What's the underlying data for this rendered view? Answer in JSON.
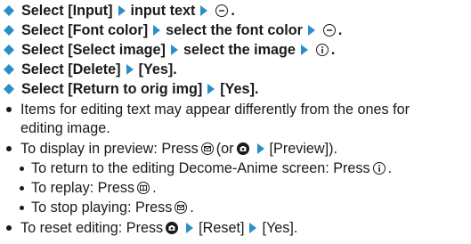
{
  "colors": {
    "accent": "#2a8fc9",
    "text": "#1a1a1a"
  },
  "steps": [
    {
      "parts": [
        "Select [Input]",
        "input text",
        "."
      ]
    },
    {
      "parts": [
        "Select [Font color]",
        "select the font color",
        "."
      ]
    },
    {
      "parts": [
        "Select [Select image]",
        "select the image",
        "."
      ]
    },
    {
      "parts": [
        "Select [Delete]",
        "[Yes]."
      ]
    },
    {
      "parts": [
        "Select [Return to orig img]",
        "[Yes]."
      ]
    }
  ],
  "notes": {
    "n1_line1": "Items for editing text may appear differently from the ones for",
    "n1_line2": "editing image.",
    "n2_a": "To display in preview: Press",
    "n2_b": "(or",
    "n2_c": "[Preview]).",
    "s1_a": "To return to the editing Decome-Anime screen: Press",
    "s1_b": ".",
    "s2_a": "To replay: Press",
    "s2_b": ".",
    "s3_a": "To stop playing: Press",
    "s3_b": ".",
    "n3_a": "To reset editing: Press",
    "n3_b": "[Reset]",
    "n3_c": "[Yes]."
  },
  "icons": [
    "diamond-bullet-icon",
    "triangle-arrow-icon",
    "minus-key-icon",
    "mail-key-icon",
    "camera-key-icon",
    "i-key-icon",
    "book-key-icon"
  ]
}
